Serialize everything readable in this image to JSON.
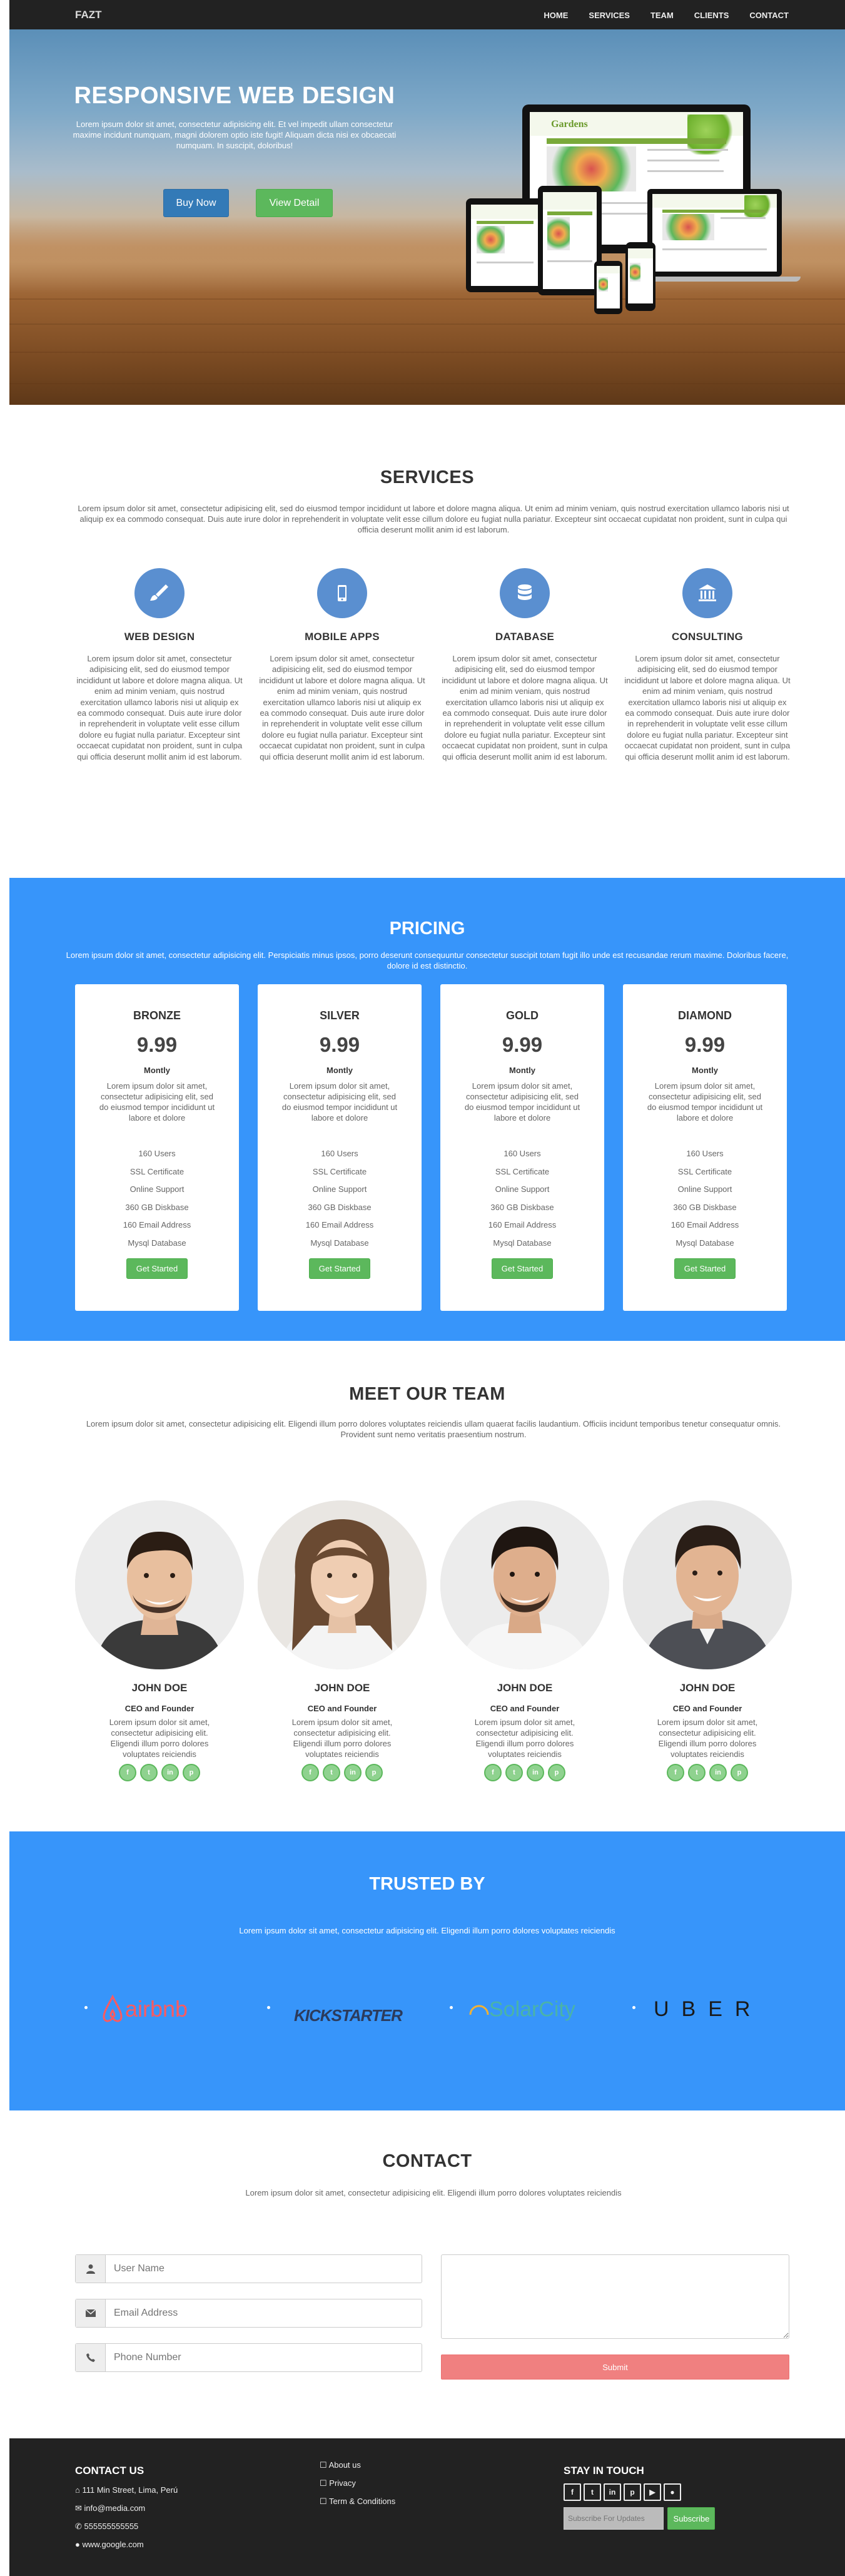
{
  "nav": {
    "brand": "FAZT",
    "items": [
      "HOME",
      "SERVICES",
      "TEAM",
      "CLIENTS",
      "CONTACT"
    ]
  },
  "hero": {
    "title": "RESPONSIVE WEB DESIGN",
    "text": "Lorem ipsum dolor sit amet, consectetur adipisicing elit. Et vel impedit ullam consectetur maxime incidunt numquam, magni dolorem optio iste fugit! Aliquam dicta nisi ex obcaecati numquam. In suscipit, doloribus!",
    "buy_label": "Buy Now",
    "view_label": "View Detail",
    "device_logo": "Gardens"
  },
  "services": {
    "title": "SERVICES",
    "lead": "Lorem ipsum dolor sit amet, consectetur adipisicing elit, sed do eiusmod tempor incididunt ut labore et dolore magna aliqua. Ut enim ad minim veniam, quis nostrud exercitation ullamco laboris nisi ut aliquip ex ea commodo consequat. Duis aute irure dolor in reprehenderit in voluptate velit esse cillum dolore eu fugiat nulla pariatur. Excepteur sint occaecat cupidatat non proident, sunt in culpa qui officia deserunt mollit anim id est laborum.",
    "items": [
      {
        "icon": "brush-icon",
        "title": "WEB DESIGN",
        "text": "Lorem ipsum dolor sit amet, consectetur adipisicing elit, sed do eiusmod tempor incididunt ut labore et dolore magna aliqua. Ut enim ad minim veniam, quis nostrud exercitation ullamco laboris nisi ut aliquip ex ea commodo consequat. Duis aute irure dolor in reprehenderit in voluptate velit esse cillum dolore eu fugiat nulla pariatur. Excepteur sint occaecat cupidatat non proident, sunt in culpa qui officia deserunt mollit anim id est laborum."
      },
      {
        "icon": "mobile-icon",
        "title": "MOBILE APPS",
        "text": "Lorem ipsum dolor sit amet, consectetur adipisicing elit, sed do eiusmod tempor incididunt ut labore et dolore magna aliqua. Ut enim ad minim veniam, quis nostrud exercitation ullamco laboris nisi ut aliquip ex ea commodo consequat. Duis aute irure dolor in reprehenderit in voluptate velit esse cillum dolore eu fugiat nulla pariatur. Excepteur sint occaecat cupidatat non proident, sunt in culpa qui officia deserunt mollit anim id est laborum."
      },
      {
        "icon": "database-icon",
        "title": "DATABASE",
        "text": "Lorem ipsum dolor sit amet, consectetur adipisicing elit, sed do eiusmod tempor incididunt ut labore et dolore magna aliqua. Ut enim ad minim veniam, quis nostrud exercitation ullamco laboris nisi ut aliquip ex ea commodo consequat. Duis aute irure dolor in reprehenderit in voluptate velit esse cillum dolore eu fugiat nulla pariatur. Excepteur sint occaecat cupidatat non proident, sunt in culpa qui officia deserunt mollit anim id est laborum."
      },
      {
        "icon": "bank-icon",
        "title": "CONSULTING",
        "text": "Lorem ipsum dolor sit amet, consectetur adipisicing elit, sed do eiusmod tempor incididunt ut labore et dolore magna aliqua. Ut enim ad minim veniam, quis nostrud exercitation ullamco laboris nisi ut aliquip ex ea commodo consequat. Duis aute irure dolor in reprehenderit in voluptate velit esse cillum dolore eu fugiat nulla pariatur. Excepteur sint occaecat cupidatat non proident, sunt in culpa qui officia deserunt mollit anim id est laborum."
      }
    ]
  },
  "pricing": {
    "title": "PRICING",
    "lead": "Lorem ipsum dolor sit amet, consectetur adipisicing elit. Perspiciatis minus ipsos, porro deserunt consequuntur consectetur suscipit totam fugit illo unde est recusandae rerum maxime. Doloribus facere, dolore id est distinctio.",
    "plans": [
      {
        "name": "BRONZE",
        "price": "9.99",
        "period": "Montly",
        "desc": "Lorem ipsum dolor sit amet, consectetur adipisicing elit, sed do eiusmod tempor incididunt ut labore et dolore",
        "features": [
          "160 Users",
          "SSL Certificate",
          "Online Support",
          "360 GB Diskbase",
          "160 Email Address",
          "Mysql Database"
        ],
        "cta": "Get Started"
      },
      {
        "name": "SILVER",
        "price": "9.99",
        "period": "Montly",
        "desc": "Lorem ipsum dolor sit amet, consectetur adipisicing elit, sed do eiusmod tempor incididunt ut labore et dolore",
        "features": [
          "160 Users",
          "SSL Certificate",
          "Online Support",
          "360 GB Diskbase",
          "160 Email Address",
          "Mysql Database"
        ],
        "cta": "Get Started"
      },
      {
        "name": "GOLD",
        "price": "9.99",
        "period": "Montly",
        "desc": "Lorem ipsum dolor sit amet, consectetur adipisicing elit, sed do eiusmod tempor incididunt ut labore et dolore",
        "features": [
          "160 Users",
          "SSL Certificate",
          "Online Support",
          "360 GB Diskbase",
          "160 Email Address",
          "Mysql Database"
        ],
        "cta": "Get Started"
      },
      {
        "name": "DIAMOND",
        "price": "9.99",
        "period": "Montly",
        "desc": "Lorem ipsum dolor sit amet, consectetur adipisicing elit, sed do eiusmod tempor incididunt ut labore et dolore",
        "features": [
          "160 Users",
          "SSL Certificate",
          "Online Support",
          "360 GB Diskbase",
          "160 Email Address",
          "Mysql Database"
        ],
        "cta": "Get Started"
      }
    ]
  },
  "team": {
    "title": "MEET OUR TEAM",
    "lead": "Lorem ipsum dolor sit amet, consectetur adipisicing elit. Eligendi illum porro dolores voluptates reiciendis ullam quaerat facilis laudantium. Officiis incidunt temporibus tenetur consequatur omnis. Provident sunt nemo veritatis praesentium nostrum.",
    "members": [
      {
        "name": "JOHN DOE",
        "role": "CEO and Founder",
        "bio": "Lorem ipsum dolor sit amet, consectetur adipisicing elit. Eligendi illum porro dolores voluptates reiciendis"
      },
      {
        "name": "JOHN DOE",
        "role": "CEO and Founder",
        "bio": "Lorem ipsum dolor sit amet, consectetur adipisicing elit. Eligendi illum porro dolores voluptates reiciendis"
      },
      {
        "name": "JOHN DOE",
        "role": "CEO and Founder",
        "bio": "Lorem ipsum dolor sit amet, consectetur adipisicing elit. Eligendi illum porro dolores voluptates reiciendis"
      },
      {
        "name": "JOHN DOE",
        "role": "CEO and Founder",
        "bio": "Lorem ipsum dolor sit amet, consectetur adipisicing elit. Eligendi illum porro dolores voluptates reiciendis"
      }
    ],
    "social_icons": [
      "facebook-icon",
      "twitter-icon",
      "linkedin-icon",
      "pinterest-icon"
    ]
  },
  "trusted": {
    "title": "TRUSTED BY",
    "lead": "Lorem ipsum dolor sit amet, consectetur adipisicing elit. Eligendi illum porro dolores voluptates reiciendis",
    "logos": [
      {
        "text": "airbnb",
        "color": "#ff5a5f"
      },
      {
        "text": "KICKSTARTER",
        "color": "#2b3b5c"
      },
      {
        "text": "SolarCity",
        "color": "#4ab3a8"
      },
      {
        "text": "UBER",
        "color": "#1a1a1a"
      }
    ]
  },
  "contact": {
    "title": "CONTACT",
    "lead": "Lorem ipsum dolor sit amet, consectetur adipisicing elit. Eligendi illum porro dolores voluptates reiciendis",
    "fields": [
      {
        "icon": "user-icon",
        "placeholder": "User Name"
      },
      {
        "icon": "envelope-icon",
        "placeholder": "Email Address"
      },
      {
        "icon": "phone-icon",
        "placeholder": "Phone Number"
      }
    ],
    "submit_label": "Submit"
  },
  "footer": {
    "contact_title": "CONTACT US",
    "contact_items": [
      {
        "icon": "home-icon",
        "text": "111 Min Street, Lima, Perú"
      },
      {
        "icon": "envelope-icon",
        "text": "info@media.com"
      },
      {
        "icon": "phone-icon",
        "text": "555555555555"
      },
      {
        "icon": "globe-icon",
        "text": "www.google.com"
      }
    ],
    "links": [
      "About us",
      "Privacy",
      "Term & Conditions"
    ],
    "touch_title": "STAY IN TOUCH",
    "social_icons": [
      "facebook-icon",
      "twitter-icon",
      "linkedin-icon",
      "pinterest-icon",
      "youtube-icon",
      "github-icon"
    ],
    "subscribe_placeholder": "Subscribe For Updates",
    "subscribe_label": "Subscribe"
  }
}
